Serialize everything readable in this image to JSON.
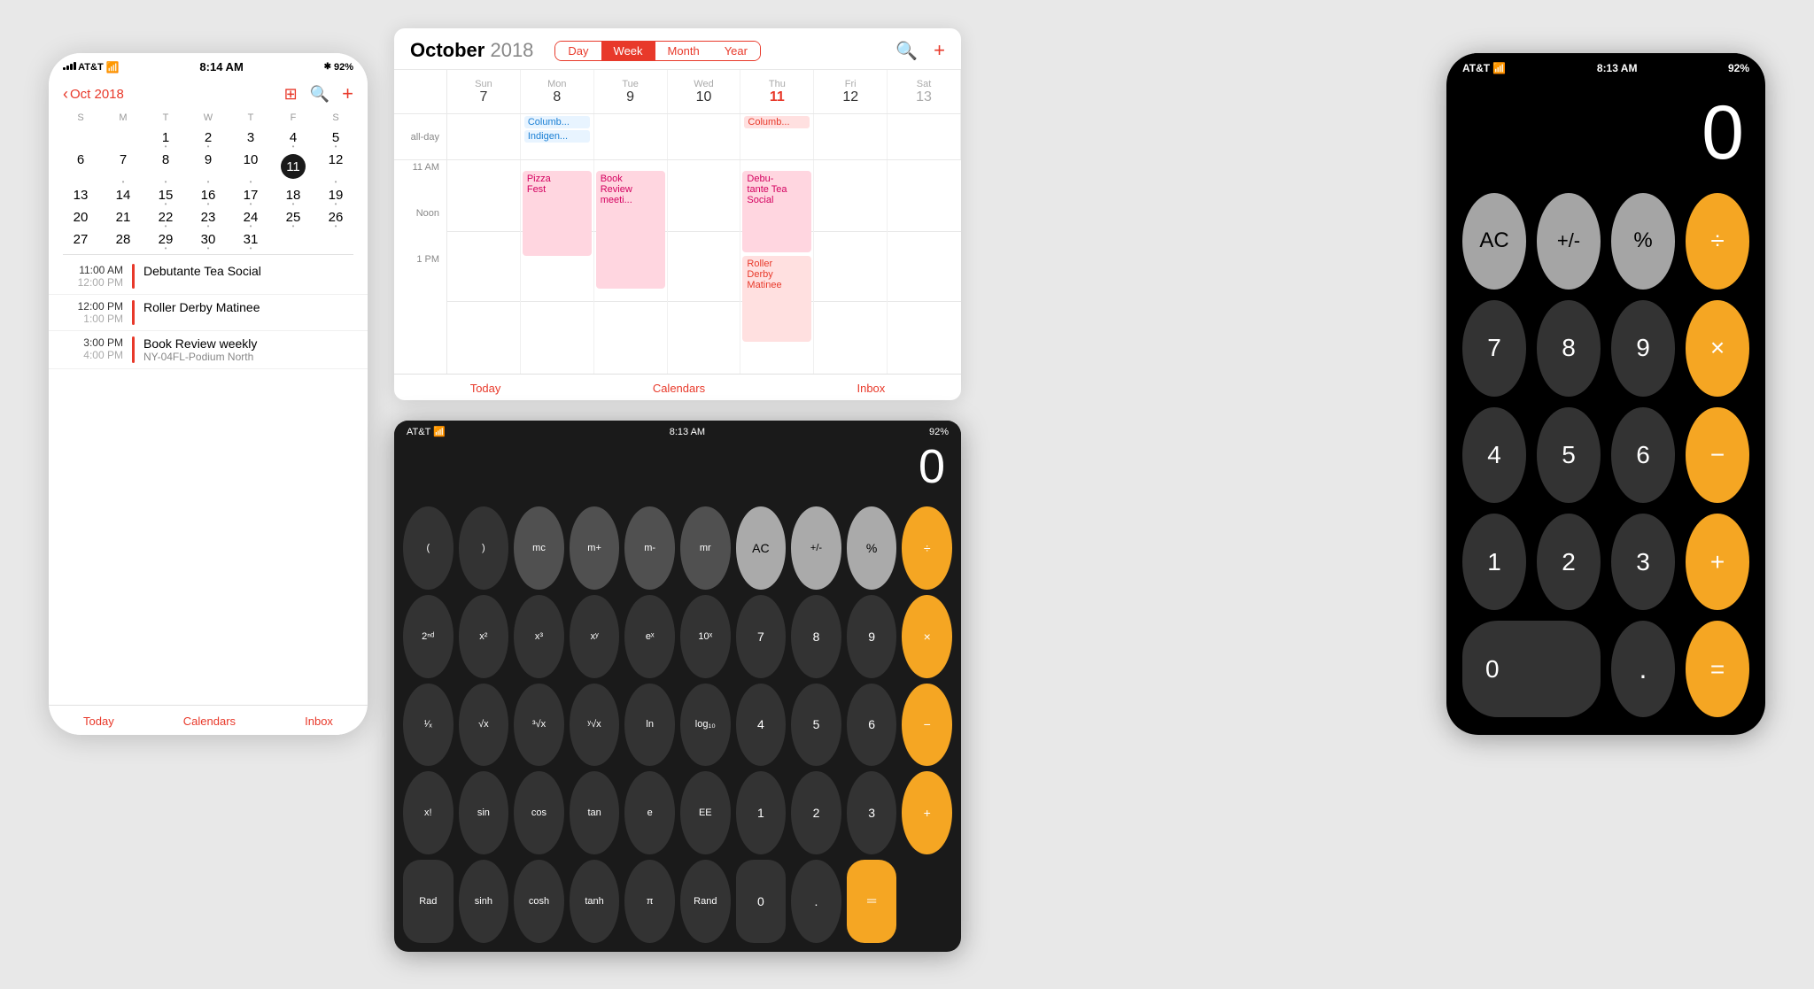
{
  "iphone_calendar": {
    "status": {
      "carrier": "AT&T",
      "time": "8:14 AM",
      "battery": "92%"
    },
    "header": {
      "back_label": "Oct 2018",
      "month_title": "Oct 2018"
    },
    "day_headers": [
      "S",
      "M",
      "T",
      "W",
      "T",
      "F",
      "S"
    ],
    "days": [
      {
        "n": "",
        "empty": true
      },
      {
        "n": "",
        "empty": true
      },
      {
        "n": "1",
        "dot": true
      },
      {
        "n": "2",
        "dot": true
      },
      {
        "n": "3"
      },
      {
        "n": "4",
        "dot": true
      },
      {
        "n": "5",
        "dot": true
      },
      {
        "n": "6"
      },
      {
        "n": "7",
        "dot": true
      },
      {
        "n": "8",
        "dot": true
      },
      {
        "n": "9",
        "dot": true
      },
      {
        "n": "10",
        "dot": true
      },
      {
        "n": "11",
        "today": true
      },
      {
        "n": "12",
        "dot": true
      },
      {
        "n": "13"
      },
      {
        "n": "14"
      },
      {
        "n": "15",
        "dot": true
      },
      {
        "n": "16",
        "dot": true
      },
      {
        "n": "17",
        "dot": true
      },
      {
        "n": "18",
        "dot": true
      },
      {
        "n": "19",
        "dot": true
      },
      {
        "n": "20"
      },
      {
        "n": "21"
      },
      {
        "n": "22",
        "dot": true
      },
      {
        "n": "23",
        "dot": true
      },
      {
        "n": "24",
        "dot": true
      },
      {
        "n": "25",
        "dot": true
      },
      {
        "n": "26",
        "dot": true
      },
      {
        "n": "27"
      },
      {
        "n": "28"
      },
      {
        "n": "29",
        "dot": true
      },
      {
        "n": "30",
        "dot": true
      },
      {
        "n": "31",
        "dot": true
      },
      {
        "n": "",
        "empty": true
      },
      {
        "n": "",
        "empty": true
      }
    ],
    "events": [
      {
        "start": "11:00 AM",
        "end": "12:00 PM",
        "name": "Debutante Tea Social",
        "sub": ""
      },
      {
        "start": "12:00 PM",
        "end": "1:00 PM",
        "name": "Roller Derby Matinee",
        "sub": ""
      },
      {
        "start": "3:00 PM",
        "end": "4:00 PM",
        "name": "Book Review weekly",
        "sub": "NY-04FL-Podium North"
      }
    ],
    "tab_bar": [
      "Today",
      "Calendars",
      "Inbox"
    ]
  },
  "ipad_calendar": {
    "title": "October",
    "title_year": "2018",
    "view_options": [
      "Day",
      "Week",
      "Month",
      "Year"
    ],
    "active_view": "Week",
    "day_headers": [
      {
        "dow": "Sun",
        "num": "7",
        "today": false
      },
      {
        "dow": "Mon",
        "num": "8",
        "today": false
      },
      {
        "dow": "Tue",
        "num": "9",
        "today": false
      },
      {
        "dow": "Wed",
        "num": "10",
        "today": false
      },
      {
        "dow": "Thu",
        "num": "11",
        "today": true
      },
      {
        "dow": "Fri",
        "num": "12",
        "today": false
      },
      {
        "dow": "Sat",
        "num": "13",
        "today": false
      }
    ],
    "allday_events": [
      {
        "col": 1,
        "text": "Columb...",
        "type": "blue"
      },
      {
        "col": 1,
        "text": "Indigen...",
        "type": "blue"
      },
      {
        "col": 4,
        "text": "Columb...",
        "type": "red"
      }
    ],
    "time_slots": [
      "11 AM",
      "Noon",
      "1 PM"
    ],
    "events": [
      {
        "col": 1,
        "top_pct": 0,
        "height_pct": 45,
        "text": "Pizza\nFest",
        "type": "pink"
      },
      {
        "col": 2,
        "top_pct": 0,
        "height_pct": 60,
        "text": "Book\nReview\nmeeti...",
        "type": "pink"
      },
      {
        "col": 3,
        "top_pct": 0,
        "height_pct": 45,
        "text": "Debu-\ntante Tea\nSocial",
        "type": "pink"
      },
      {
        "col": 3,
        "top_pct": 48,
        "height_pct": 45,
        "text": "Roller\nDerby\nMatinee",
        "type": "red"
      }
    ],
    "tab_bar": [
      "Today",
      "Calendars",
      "Inbox"
    ]
  },
  "sci_calculator": {
    "status": {
      "carrier": "AT&T",
      "time": "8:13 AM",
      "battery": "92%"
    },
    "display": "0",
    "buttons": [
      [
        "(",
        ")",
        "mc",
        "m+",
        "m-",
        "mr",
        "AC",
        "+/-",
        "%",
        "÷"
      ],
      [
        "2ⁿᵈ",
        "x²",
        "x³",
        "xʸ",
        "eˣ",
        "10ˣ",
        "7",
        "8",
        "9",
        "×"
      ],
      [
        "¹⁄ₓ",
        "√x",
        "³√x",
        "ʸ√x",
        "ln",
        "log₁₀",
        "4",
        "5",
        "6",
        "−"
      ],
      [
        "x!",
        "sin",
        "cos",
        "tan",
        "e",
        "EE",
        "1",
        "2",
        "3",
        "+"
      ],
      [
        "Rad",
        "sinh",
        "cosh",
        "tanh",
        "π",
        "Rand",
        "0",
        ".",
        "=",
        ""
      ]
    ],
    "button_types": [
      [
        "dark",
        "dark",
        "gray",
        "gray",
        "gray",
        "gray",
        "light-gray",
        "light-gray",
        "light-gray",
        "orange"
      ],
      [
        "dark",
        "dark",
        "dark",
        "dark",
        "dark",
        "dark",
        "dark",
        "dark",
        "dark",
        "orange"
      ],
      [
        "dark",
        "dark",
        "dark",
        "dark",
        "dark",
        "dark",
        "dark",
        "dark",
        "dark",
        "orange"
      ],
      [
        "dark",
        "dark",
        "dark",
        "dark",
        "dark",
        "dark",
        "dark",
        "dark",
        "dark",
        "orange"
      ],
      [
        "dark",
        "dark",
        "dark",
        "dark",
        "dark",
        "dark",
        "dark",
        "dark",
        "orange",
        ""
      ]
    ]
  },
  "iphone_calculator": {
    "status": {
      "carrier": "AT&T",
      "time": "8:13 AM",
      "battery": "92%"
    },
    "display": "0",
    "buttons": [
      [
        "AC",
        "+/-",
        "%",
        "÷"
      ],
      [
        "7",
        "8",
        "9",
        "×"
      ],
      [
        "4",
        "5",
        "6",
        "−"
      ],
      [
        "1",
        "2",
        "3",
        "+"
      ],
      [
        "0",
        "",
        ".",
        "="
      ]
    ],
    "button_types": [
      [
        "gray",
        "gray",
        "gray",
        "orange"
      ],
      [
        "dark",
        "dark",
        "dark",
        "orange"
      ],
      [
        "dark",
        "dark",
        "dark",
        "orange"
      ],
      [
        "dark",
        "dark",
        "dark",
        "orange"
      ],
      [
        "dark-zero",
        "",
        "dark",
        "orange"
      ]
    ]
  }
}
